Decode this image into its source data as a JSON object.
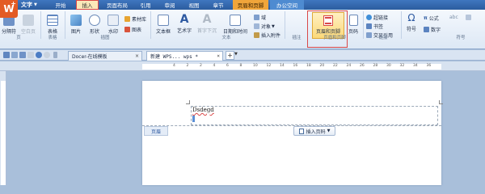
{
  "app": {
    "logo_glyph": "W",
    "name": "文字"
  },
  "menu": [
    "开始",
    "插入",
    "页面布局",
    "引用",
    "审阅",
    "视图",
    "章节",
    "页眉和页脚",
    "办公空间"
  ],
  "ribbon": {
    "page": "分隔符",
    "page_gray": "空白页",
    "table": "表格",
    "picture": "图片",
    "shapes": "形状",
    "watermark": "水印",
    "gallery": "素材库",
    "chart": "图表",
    "textbox": "文本框",
    "wordart": "艺术字",
    "first_drop": "首字下沉",
    "datetime": "日期和时间",
    "field": "域",
    "object": "对象",
    "attachment": "插入附件",
    "header_footer": "页眉和页脚",
    "page_num": "页码",
    "hyperlink": "超链接",
    "bookmark": "书签",
    "cross_ref": "交叉引用",
    "symbol": "符号",
    "formula": "公式",
    "number": "数字",
    "groups": {
      "page": "页",
      "table": "表格",
      "illus": "插图",
      "text": "文本",
      "insert": "插注",
      "hf": "页眉和页脚",
      "link": "链接",
      "symbol": "符号"
    }
  },
  "tabs": {
    "docer": "Docer-在线模板",
    "doc": "新建 WPS... wps *",
    "docer_close": "×",
    "doc_close": "×",
    "new_tab": "+"
  },
  "ruler_ticks": [
    "4",
    "2",
    "2",
    "4",
    "6",
    "8",
    "10",
    "12",
    "14",
    "16",
    "18",
    "20",
    "22",
    "24",
    "26",
    "28",
    "30",
    "32",
    "34",
    "36"
  ],
  "document": {
    "header_text": "Dsdegd",
    "header_label": "页眉",
    "insert_page_num": "插入页码"
  },
  "colors": {
    "menubar": "#2c5d9f",
    "accent_orange": "#e35b24",
    "highlight_red": "#d94848",
    "active_tab_bg": "#fbe8b9"
  }
}
